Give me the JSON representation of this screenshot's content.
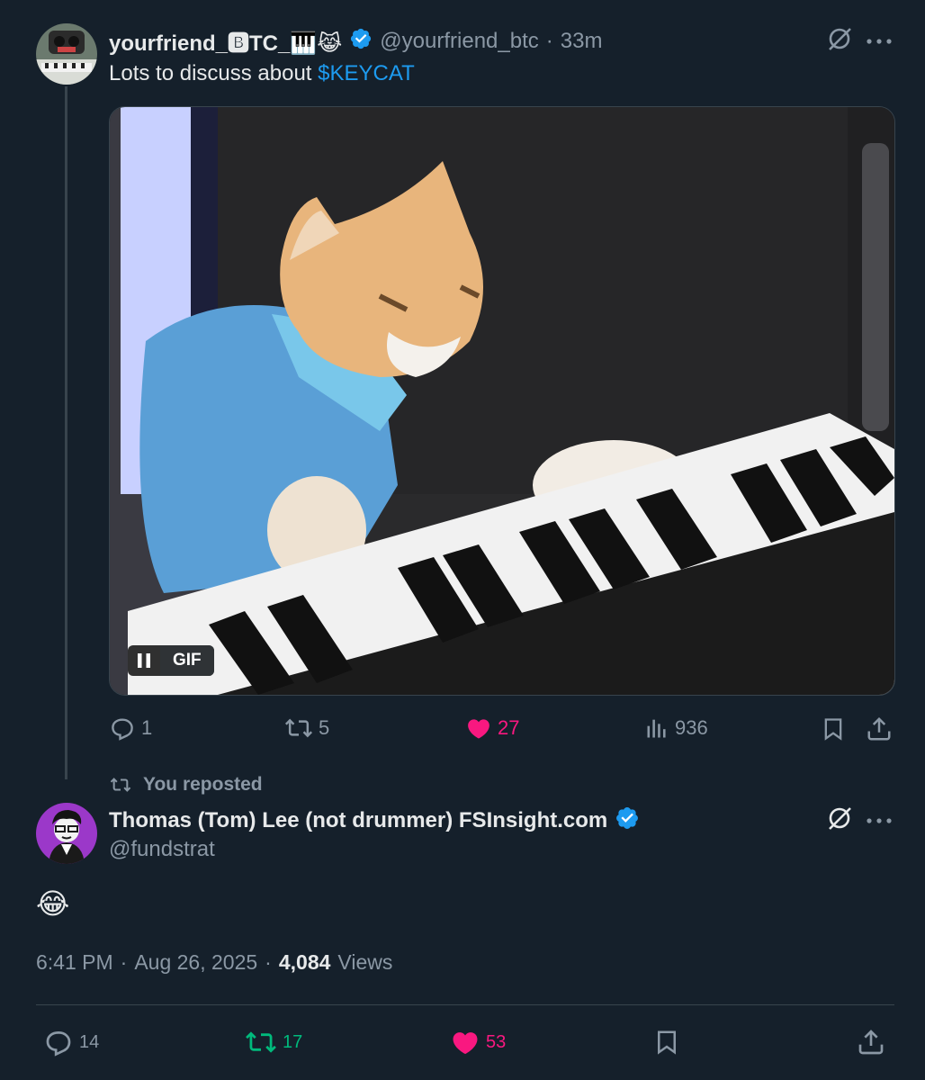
{
  "post": {
    "display_name": "yourfriend_🅱TC_🎹😹",
    "handle": "@yourfriend_btc",
    "separator": "·",
    "time_ago": "33m",
    "text_prefix": "Lots to discuss about ",
    "cashtag": "$KEYCAT",
    "gif_label": "GIF",
    "actions": {
      "replies": "1",
      "reposts": "5",
      "likes": "27",
      "views": "936"
    }
  },
  "repost_notice": "You reposted",
  "main": {
    "display_name": "Thomas (Tom) Lee (not drummer) FSInsight.com",
    "handle": "@fundstrat",
    "text": "😂",
    "time": "6:41 PM",
    "sep1": "·",
    "date": "Aug 26, 2025",
    "sep2": "·",
    "views_count": "4,084",
    "views_label": "Views",
    "actions": {
      "replies": "14",
      "reposts": "17",
      "likes": "53"
    }
  },
  "colors": {
    "background": "#15202b",
    "text": "#e7e9ea",
    "muted": "#8b98a5",
    "link": "#1d9bf0",
    "like": "#f91880",
    "repost_active": "#00ba7c",
    "verified": "#1d9bf0"
  }
}
